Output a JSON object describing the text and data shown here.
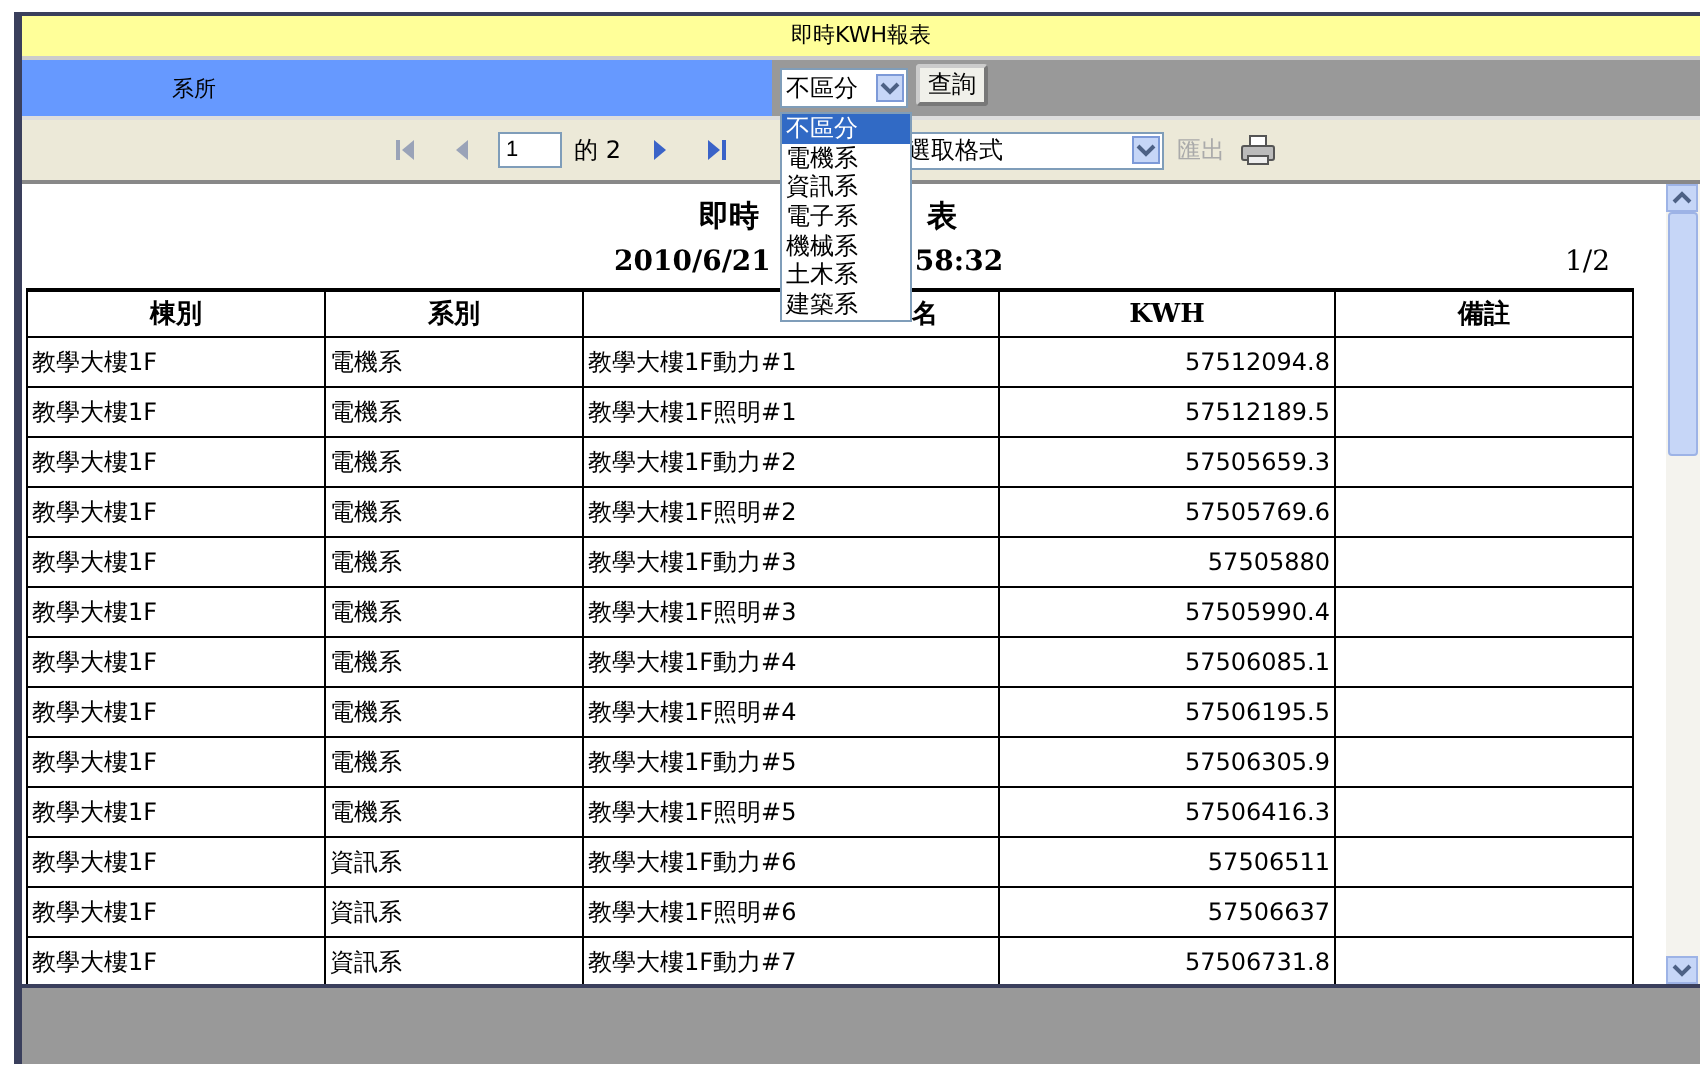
{
  "window": {
    "title": "即時KWH報表"
  },
  "filter": {
    "label": "系所",
    "select_value": "不區分",
    "button": "查詢",
    "options": [
      {
        "label": "不區分",
        "selected": true
      },
      {
        "label": "電機系",
        "selected": false
      },
      {
        "label": "資訊系",
        "selected": false
      },
      {
        "label": "電子系",
        "selected": false
      },
      {
        "label": "機械系",
        "selected": false
      },
      {
        "label": "土木系",
        "selected": false
      },
      {
        "label": "建築系",
        "selected": false
      }
    ]
  },
  "toolbar": {
    "page_value": "1",
    "page_total": "的 2",
    "format_select": "選取格式",
    "export": "匯出",
    "export_disabled": true
  },
  "report": {
    "title_parts": [
      "即時",
      "表"
    ],
    "date_parts": [
      "2010/6/21",
      "58:32"
    ],
    "page_indicator": "1/2",
    "columns": [
      "棟別",
      "系別",
      "名",
      "KWH",
      "備註"
    ],
    "rows": [
      [
        "教學大樓1F",
        "電機系",
        "教學大樓1F動力#1",
        "57512094.8",
        ""
      ],
      [
        "教學大樓1F",
        "電機系",
        "教學大樓1F照明#1",
        "57512189.5",
        ""
      ],
      [
        "教學大樓1F",
        "電機系",
        "教學大樓1F動力#2",
        "57505659.3",
        ""
      ],
      [
        "教學大樓1F",
        "電機系",
        "教學大樓1F照明#2",
        "57505769.6",
        ""
      ],
      [
        "教學大樓1F",
        "電機系",
        "教學大樓1F動力#3",
        "57505880",
        ""
      ],
      [
        "教學大樓1F",
        "電機系",
        "教學大樓1F照明#3",
        "57505990.4",
        ""
      ],
      [
        "教學大樓1F",
        "電機系",
        "教學大樓1F動力#4",
        "57506085.1",
        ""
      ],
      [
        "教學大樓1F",
        "電機系",
        "教學大樓1F照明#4",
        "57506195.5",
        ""
      ],
      [
        "教學大樓1F",
        "電機系",
        "教學大樓1F動力#5",
        "57506305.9",
        ""
      ],
      [
        "教學大樓1F",
        "電機系",
        "教學大樓1F照明#5",
        "57506416.3",
        ""
      ],
      [
        "教學大樓1F",
        "資訊系",
        "教學大樓1F動力#6",
        "57506511",
        ""
      ],
      [
        "教學大樓1F",
        "資訊系",
        "教學大樓1F照明#6",
        "57506637",
        ""
      ],
      [
        "教學大樓1F",
        "資訊系",
        "教學大樓1F動力#7",
        "57506731.8",
        ""
      ]
    ]
  }
}
